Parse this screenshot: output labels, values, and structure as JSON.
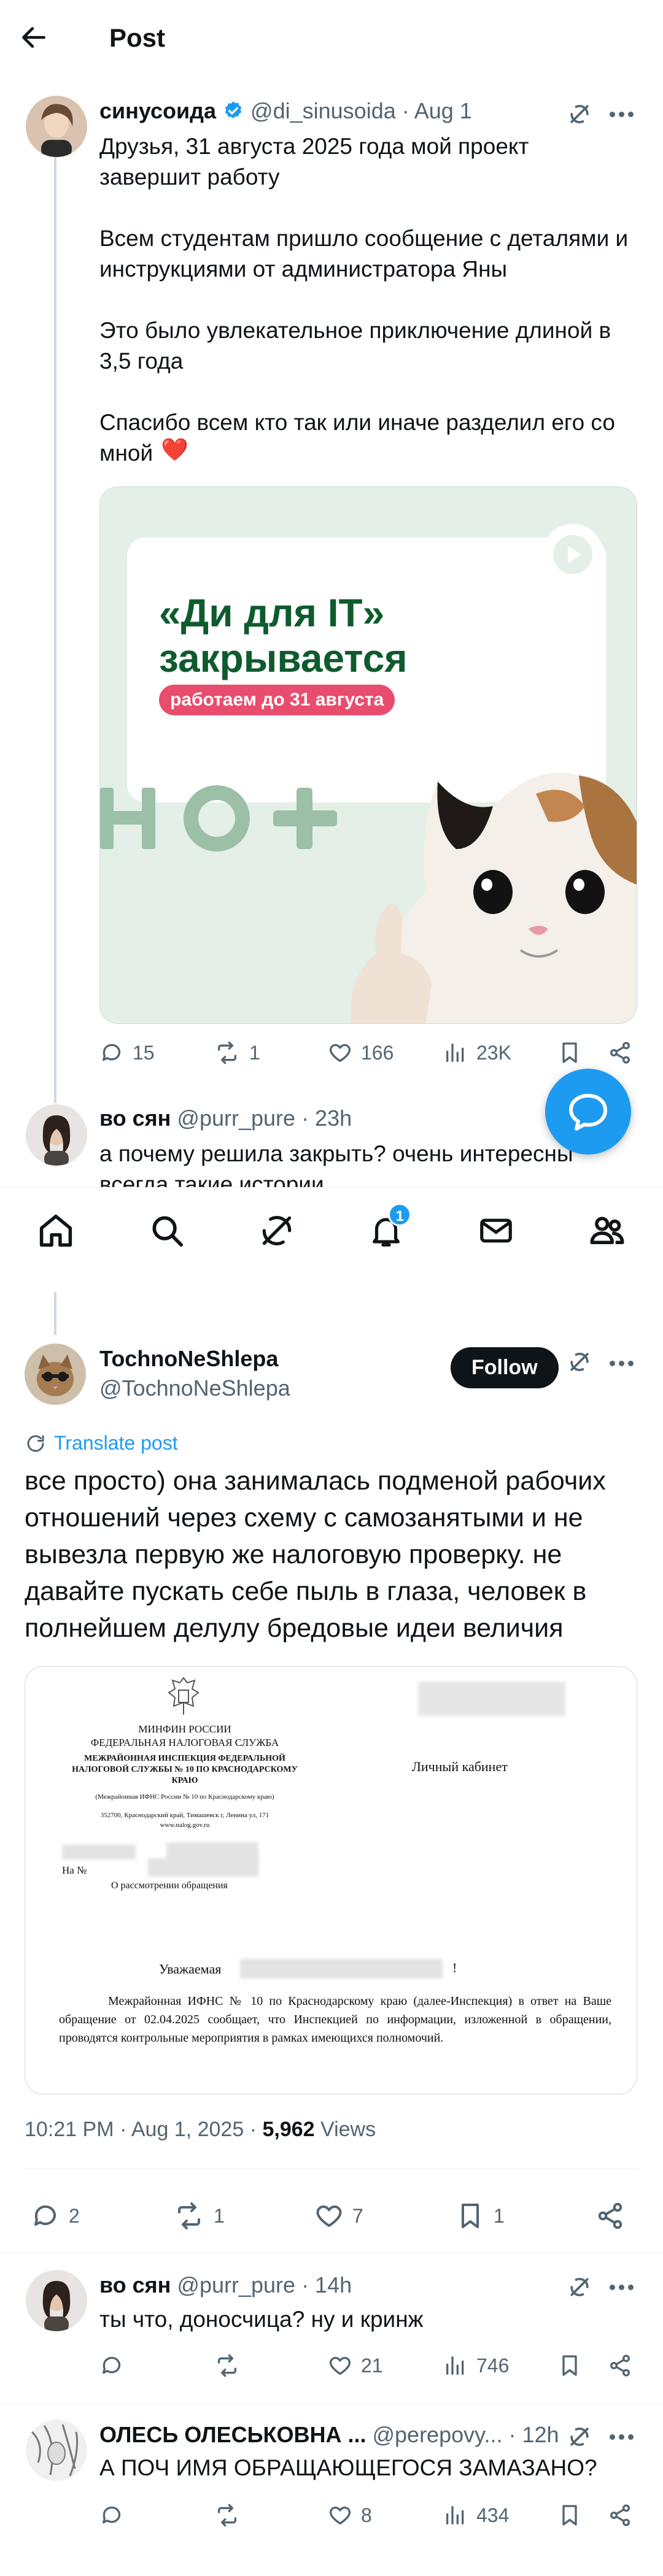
{
  "header": {
    "title": "Post"
  },
  "post1": {
    "author_name": "синусоида",
    "author_handle": "@di_sinusoida",
    "time": "· Aug 1",
    "text": "Друзья, 31 августа 2025 года мой проект завершит работу\n\nВсем студентам пришло сообщение с деталями и инструкциями от администратора Яны\n\nЭто было увлекательное приключение длиной в 3,5 года\n\nСпасибо всем кто так или иначе разделил его со мной",
    "emoji": "❤️",
    "image": {
      "headline_line1": "«Ди для IT»",
      "headline_line2": "закрывается",
      "pill": "работаем до 31 августа"
    },
    "stats": {
      "replies": "15",
      "reposts": "1",
      "likes": "166",
      "views": "23K"
    }
  },
  "reply1": {
    "author_name": "во сян",
    "author_handle": "@purr_pure",
    "time": "· 23h",
    "text_line1": "а почему решила закрыть? очень интересны",
    "text_line2": "всегда такие истории"
  },
  "nav": {
    "notifications_badge": "1"
  },
  "post2": {
    "author_name": "TochnoNeShlepa",
    "author_handle": "@TochnoNeShlepa",
    "follow_label": "Follow",
    "translate_label": "Translate post",
    "text": "все просто) она занималась подменой рабочих отношений через схему с самозанятыми и не вывезла первую же налоговую проверку. не давайте пускать себе пыль в глаза, человек в полнейшем делулу бредовые идеи величия",
    "doc": {
      "ministry": "МИНФИН РОССИИ",
      "service": "ФЕДЕРАЛЬНАЯ НАЛОГОВАЯ СЛУЖБА",
      "inspection_l1": "МЕЖРАЙОННАЯ ИНСПЕКЦИЯ ФЕДЕРАЛЬНОЙ",
      "inspection_l2": "НАЛОГОВОЙ СЛУЖБЫ № 10 ПО КРАСНОДАРСКОМУ",
      "inspection_l3": "КРАЮ",
      "abbr": "(Межрайонная ИФНС России № 10 по Краснодарскому краю)",
      "address": "352700, Краснодарский край, Тимашевск г, Ленина ул, 171",
      "site": "www.nalog.gov.ru",
      "cabinet": "Личный кабинет",
      "ref_no": "На №",
      "subject": "О рассмотрении обращения",
      "greeting": "Уважаемая",
      "body": "Межрайонная ИФНС № 10 по Краснодарскому краю (далее-Инспекция) в ответ на Ваше обращение от 02.04.2025 сообщает, что Инспекцией по информации, изложенной в обращении, проводятся контрольные мероприятия в рамках имеющихся полномочий."
    },
    "timestamp": "10:21 PM · Aug 1, 2025 · ",
    "views_count": "5,962",
    "views_label": " Views",
    "stats": {
      "replies": "2",
      "reposts": "1",
      "likes": "7",
      "bookmarks": "1"
    }
  },
  "reply2": {
    "author_name": "во сян",
    "author_handle": "@purr_pure",
    "time": "· 14h",
    "text": "ты что, доносчица? ну и кринж",
    "stats": {
      "likes": "21",
      "views": "746"
    }
  },
  "reply3": {
    "author_name": "ОЛЕСЬ ОЛЕСЬКОВНА ...",
    "author_handle": "@perepovy...",
    "time": "· 12h",
    "text": "А ПОЧ ИМЯ ОБРАЩАЮЩЕГОСЯ ЗАМАЗАНО?",
    "stats": {
      "likes": "8",
      "views": "434"
    }
  },
  "colors": {
    "accent": "#1d9bf0",
    "verified": "#1d9bf0",
    "heart": "#f91880",
    "text": "#0f1419",
    "muted": "#536471"
  }
}
